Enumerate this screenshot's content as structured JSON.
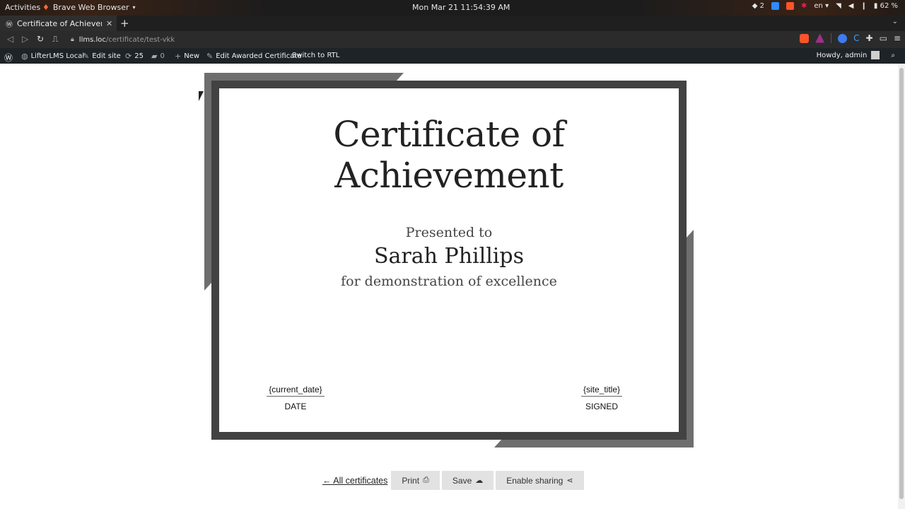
{
  "system_bar": {
    "activities": "Activities",
    "app_name": "Brave Web Browser",
    "clock": "Mon Mar 21  11:54:39 AM",
    "notif_count": "2",
    "lang": "en",
    "battery": "62 %"
  },
  "browser": {
    "tab_title": "Certificate of Achievement",
    "url_host": "llms.loc",
    "url_path": "/certificate/test-vkk"
  },
  "wp_admin_bar": {
    "site_name": "LifterLMS Local",
    "edit_site": "Edit site",
    "updates_count": "25",
    "comments_count": "0",
    "new": "New",
    "edit_certificate": "Edit Awarded Certificate",
    "switch_rtl": "Switch to RTL",
    "howdy": "Howdy, admin"
  },
  "certificate": {
    "title": "Certificate of Achievement",
    "presented_to": "Presented to",
    "recipient": "Sarah Phillips",
    "reason": "for demonstration of excellence",
    "date_value": "{current_date}",
    "date_label": "DATE",
    "signed_value": "{site_title}",
    "signed_label": "SIGNED"
  },
  "actions": {
    "all_certificates": "← All certificates",
    "print": "Print",
    "save": "Save",
    "enable_sharing": "Enable sharing"
  },
  "colors": {
    "frame": "#424242",
    "deco": "#6e6e6e",
    "wp_bar": "#1d2327"
  }
}
